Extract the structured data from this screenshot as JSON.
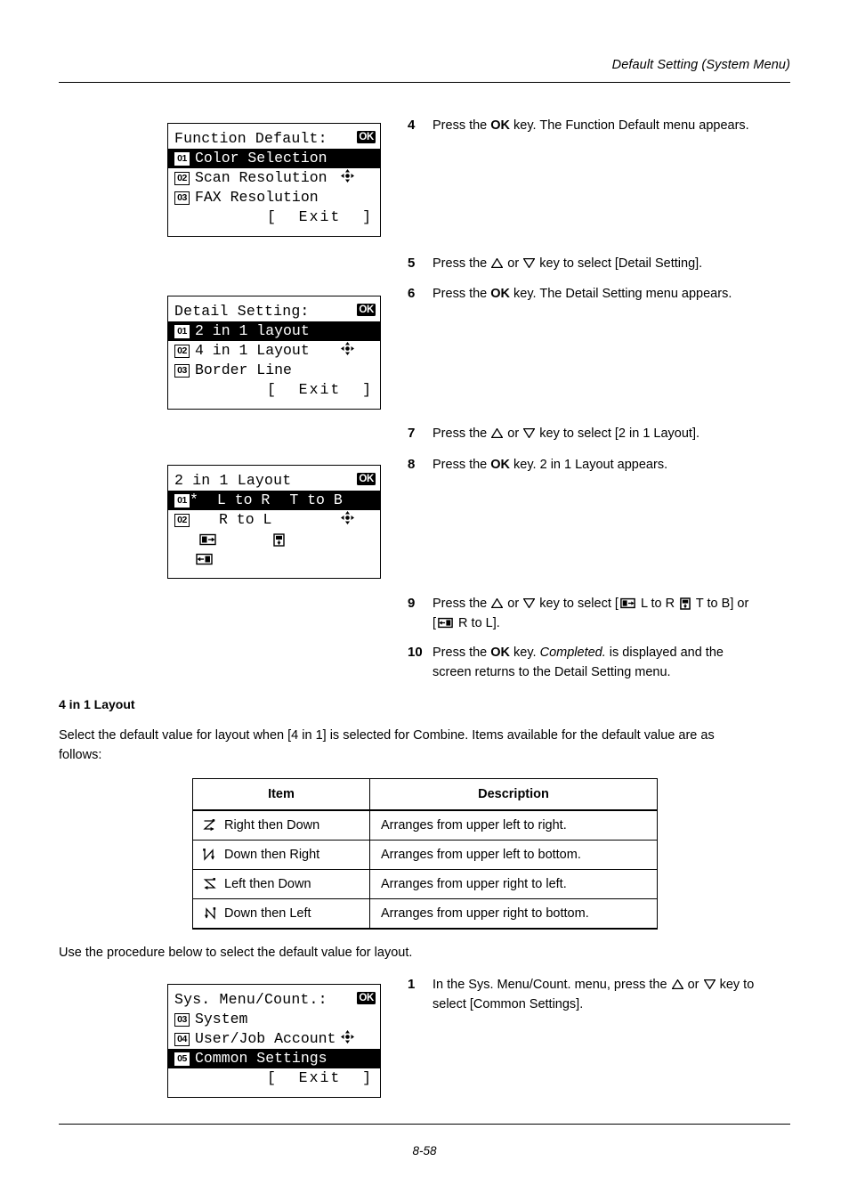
{
  "header": {
    "title": "Default Setting (System Menu)"
  },
  "footer": {
    "page_number": "8-58"
  },
  "screens": {
    "function_default": {
      "title": "Function Default:",
      "ok_label": "OK",
      "items": [
        {
          "num": "01",
          "label": "Color Selection",
          "selected": true
        },
        {
          "num": "02",
          "label": "Scan Resolution",
          "selected": false
        },
        {
          "num": "03",
          "label": "FAX Resolution",
          "selected": false
        }
      ],
      "exit_label": "[  Exit  ]"
    },
    "detail_setting": {
      "title": "Detail Setting:",
      "ok_label": "OK",
      "items": [
        {
          "num": "01",
          "label": "2 in 1 layout",
          "selected": true
        },
        {
          "num": "02",
          "label": "4 in 1 Layout",
          "selected": false
        },
        {
          "num": "03",
          "label": "Border Line",
          "selected": false
        }
      ],
      "exit_label": "[  Exit  ]"
    },
    "two_in_one_layout": {
      "title": "2 in 1 Layout",
      "ok_label": "OK",
      "items": [
        {
          "num": "01",
          "star": "*",
          "label_a": "L to R",
          "label_b": "T to B",
          "selected": true
        },
        {
          "num": "02",
          "star": "",
          "label_a": "R to L",
          "label_b": "",
          "selected": false
        }
      ]
    },
    "sys_menu_count": {
      "title": "Sys. Menu/Count.:",
      "ok_label": "OK",
      "items": [
        {
          "num": "03",
          "label": "System",
          "selected": false
        },
        {
          "num": "04",
          "label": "User/Job Account",
          "selected": false
        },
        {
          "num": "05",
          "label": "Common Settings",
          "selected": true
        }
      ],
      "exit_label": "[  Exit  ]"
    }
  },
  "steps": {
    "step4": {
      "num": "4",
      "text_a": "Press the ",
      "bold_a": "OK",
      "text_b": " key. The Function Default menu appears."
    },
    "step5": {
      "num": "5",
      "text_a": "Press the ",
      "text_b": " or ",
      "text_c": " key to select [Detail Setting]."
    },
    "step6": {
      "num": "6",
      "text_a": "Press the ",
      "bold_a": "OK",
      "text_b": " key. The Detail Setting menu appears."
    },
    "step7": {
      "num": "7",
      "text_a": "Press the ",
      "text_b": " or ",
      "text_c": " key to select [2 in 1 Layout]."
    },
    "step8": {
      "num": "8",
      "text_a": "Press the ",
      "bold_a": "OK",
      "text_b": " key. 2 in 1 Layout appears."
    },
    "step9": {
      "num": "9",
      "text_a": "Press the ",
      "text_b": " or ",
      "text_c": " key to select [",
      "text_d": " L to R ",
      "text_e": " T to B] or",
      "text_f": "[",
      "text_g": " R to L]."
    },
    "step10": {
      "num": "10",
      "text_a": "Press the ",
      "bold_a": "OK",
      "text_b": " key. ",
      "italic_a": "Completed.",
      "text_c": " is displayed and the",
      "text_d": "screen returns to the Detail Setting menu."
    },
    "step1_bottom": {
      "num": "1",
      "text_a": "In the Sys. Menu/Count. menu, press the ",
      "text_b": " or ",
      "text_c": " key to",
      "text_d": "select [Common Settings]."
    }
  },
  "section": {
    "heading": "4 in 1 Layout",
    "intro_line1": "Select the default value for layout when [4 in 1] is selected for Combine. Items available for the default value are as",
    "intro_line2": "follows:",
    "outro": "Use the procedure below to select the default value for layout."
  },
  "table": {
    "headers": [
      "Item",
      "Description"
    ],
    "rows": [
      {
        "icon": "right-then-down-icon",
        "item": "Right then Down",
        "description": "Arranges from upper left to right."
      },
      {
        "icon": "down-then-right-icon",
        "item": "Down then Right",
        "description": "Arranges from upper left to bottom."
      },
      {
        "icon": "left-then-down-icon",
        "item": "Left then Down",
        "description": "Arranges from upper right to left."
      },
      {
        "icon": "down-then-left-icon",
        "item": "Down then Left",
        "description": "Arranges from upper right to bottom."
      }
    ]
  },
  "colors": {
    "ink": "#000000",
    "paper": "#ffffff"
  }
}
